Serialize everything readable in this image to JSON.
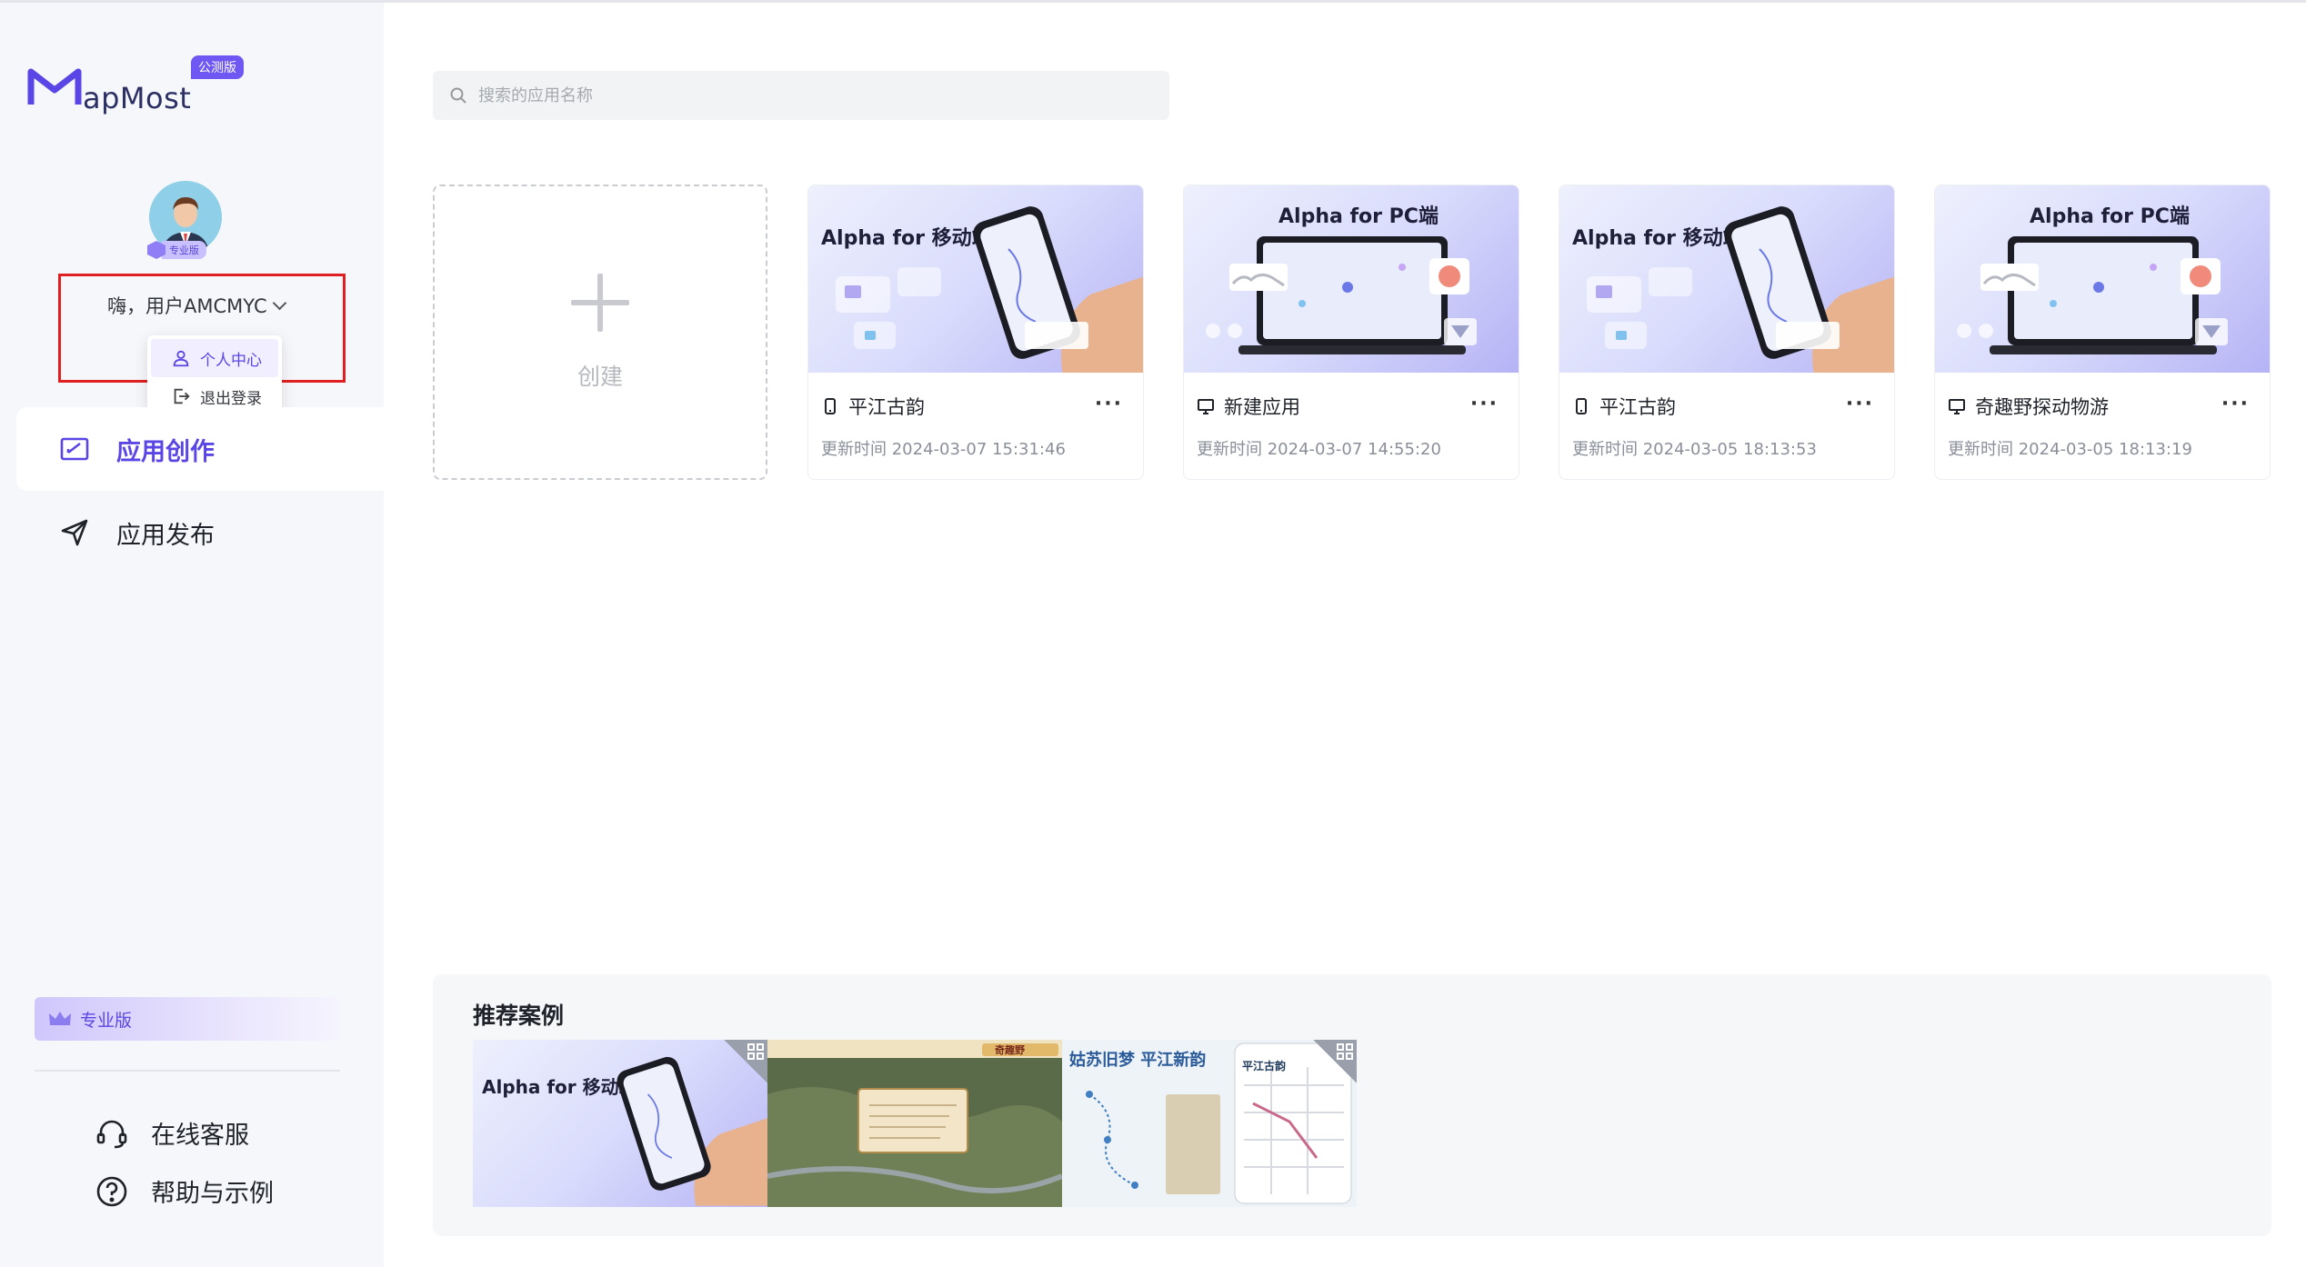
{
  "brand": {
    "name": "apMost",
    "badge": "公测版"
  },
  "user": {
    "level_badge": "专业版",
    "greeting": "嗨，用户AMCMYC",
    "menu": [
      {
        "label": "个人中心"
      },
      {
        "label": "退出登录"
      }
    ]
  },
  "nav": [
    {
      "label": "应用创作"
    },
    {
      "label": "应用发布"
    }
  ],
  "sidebar_footer": {
    "pro_label": "专业版",
    "links": [
      {
        "label": "在线客服"
      },
      {
        "label": "帮助与示例"
      }
    ]
  },
  "search": {
    "placeholder": "搜索的应用名称"
  },
  "create": {
    "label": "创建"
  },
  "apps": [
    {
      "thumb_title": "Alpha for 移动端",
      "platform": "mobile",
      "name": "平江古韵",
      "updated": "更新时间 2024-03-07 15:31:46"
    },
    {
      "thumb_title": "Alpha for PC端",
      "platform": "pc",
      "name": "新建应用",
      "updated": "更新时间 2024-03-07 14:55:20"
    },
    {
      "thumb_title": "Alpha for 移动端",
      "platform": "mobile",
      "name": "平江古韵",
      "updated": "更新时间 2024-03-05 18:13:53"
    },
    {
      "thumb_title": "Alpha for PC端",
      "platform": "pc",
      "name": "奇趣野探动物游",
      "updated": "更新时间 2024-03-05 18:13:19"
    }
  ],
  "more_label": "···",
  "recommend": {
    "title": "推荐案例",
    "cases": [
      {
        "title": "Alpha for 移动端"
      },
      {
        "title": "奇趣野"
      },
      {
        "title": "姑苏旧梦 平江新韵",
        "sub": "平江古韵"
      }
    ]
  },
  "colors": {
    "accent": "#5a46e6",
    "alert_box": "#e02020",
    "sidebar_bg": "#f6f7fa"
  }
}
